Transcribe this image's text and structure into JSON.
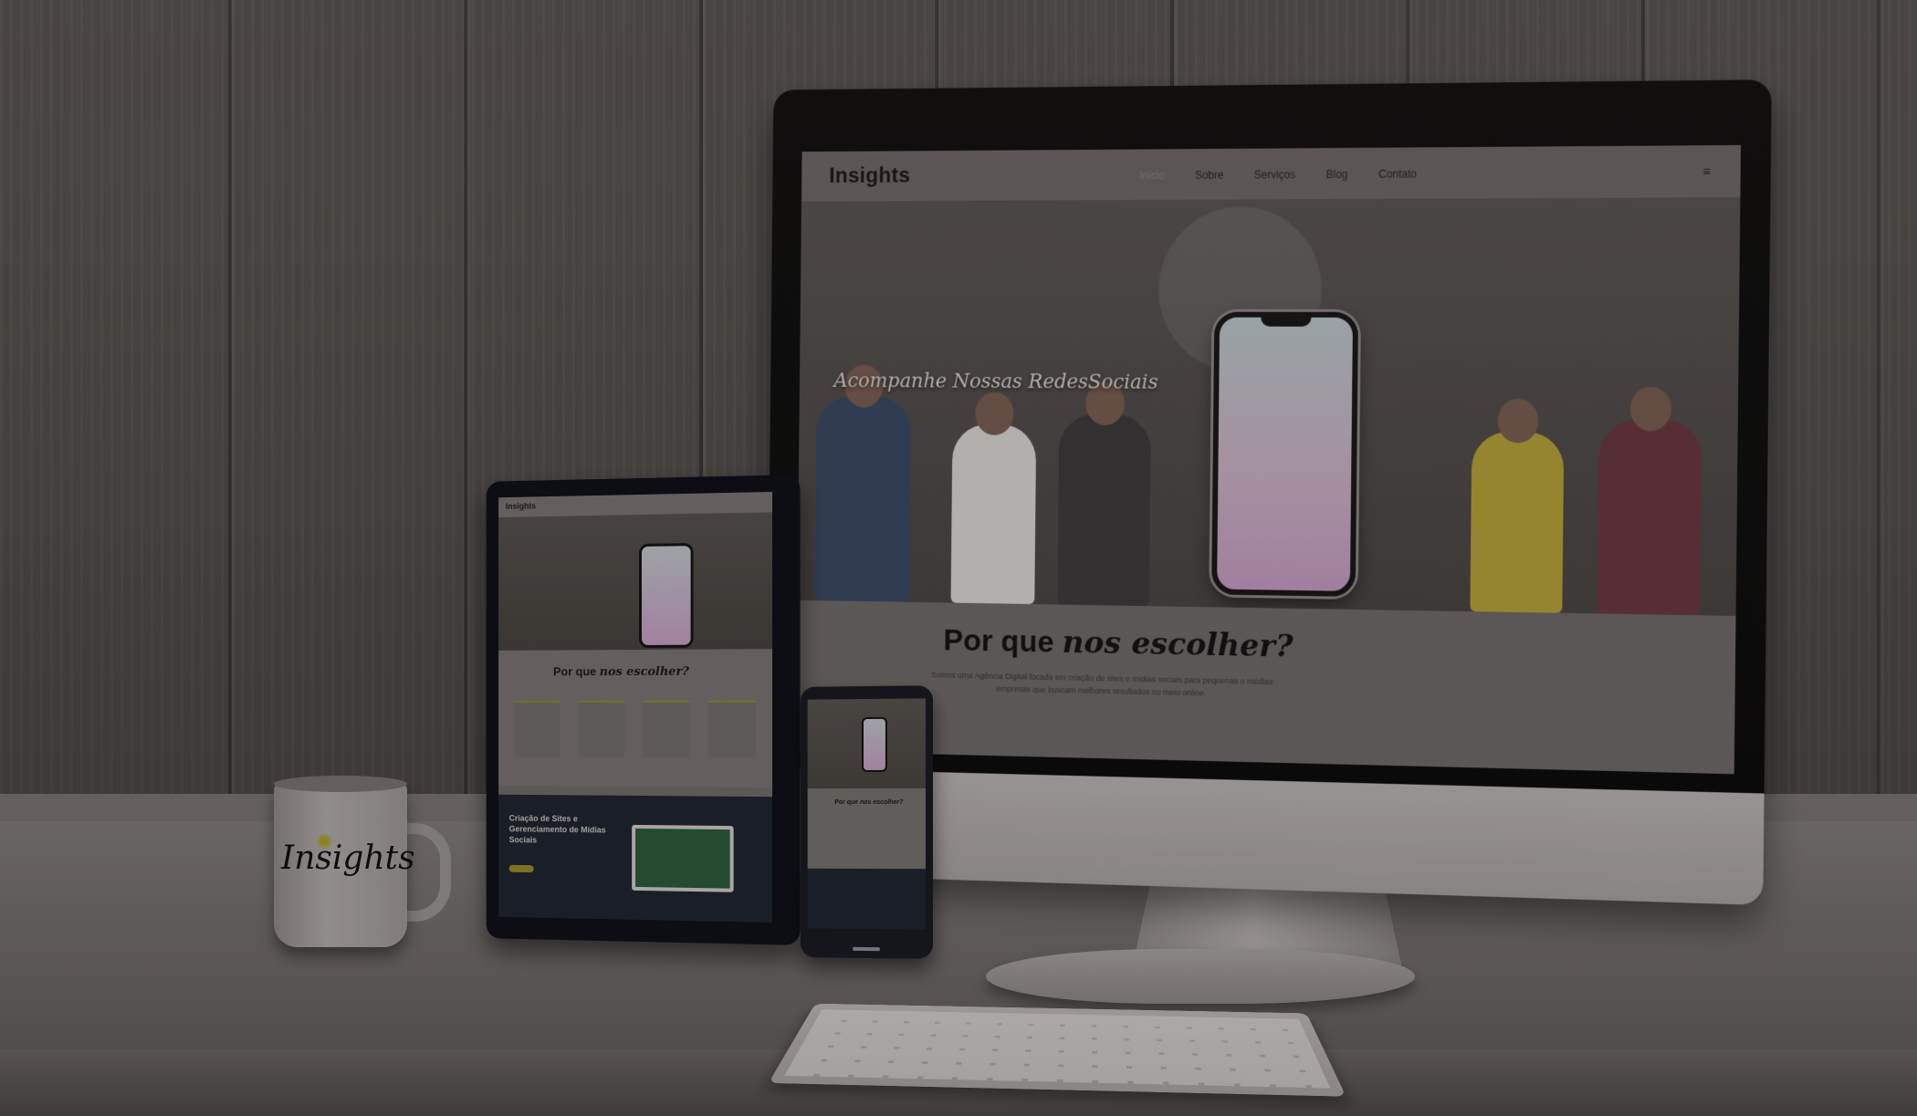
{
  "scene": {
    "description_colors": {
      "wall": "#575350",
      "desk": "#706b69",
      "accent": "#a7a11f"
    }
  },
  "monitor": {
    "site": {
      "logo": "Insights",
      "menu": [
        "Início",
        "Sobre",
        "Serviços",
        "Blog",
        "Contato"
      ],
      "menu_icon": "≡",
      "hero_title": "Acompanhe Nossas RedesSociais",
      "why_title_plain": "Por que ",
      "why_title_italic": "nos escolher?",
      "why_text": "Somos uma Agência Digital focada em criação de sites e mídias sociais para pequenas e médias empresas que buscam melhores resultados no meio online."
    }
  },
  "tablet": {
    "site": {
      "logo": "Insights",
      "why_title_plain": "Por que ",
      "why_title_italic": "nos escolher?",
      "dark_title": "Criação de Sites e Gerenciamento de Mídias Sociais"
    }
  },
  "phone": {
    "site": {
      "why_title_plain": "Por que ",
      "why_title_italic": "nos escolher?"
    }
  },
  "mug": {
    "logo": "Insights",
    "icon": "lightbulb-icon"
  }
}
